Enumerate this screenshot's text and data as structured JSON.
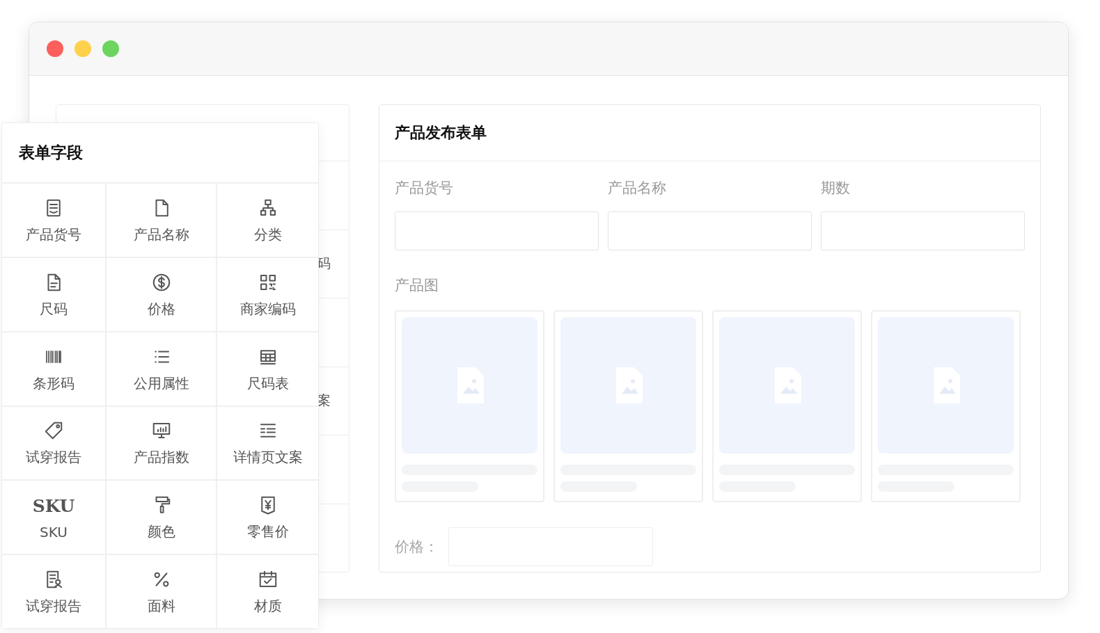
{
  "window": {
    "controls": [
      {
        "color": "#fc605c"
      },
      {
        "color": "#fdd14b"
      },
      {
        "color": "#6cd45f"
      }
    ]
  },
  "back_panel": {
    "rows": [
      {
        "text": ""
      },
      {
        "text": "码"
      },
      {
        "text": ""
      },
      {
        "text": "案"
      },
      {
        "text": ""
      },
      {
        "text": ""
      }
    ]
  },
  "field_palette": {
    "title": "表单字段",
    "items": [
      {
        "label": "产品货号",
        "kind": "icon"
      },
      {
        "label": "产品名称",
        "kind": "icon"
      },
      {
        "label": "分类",
        "kind": "icon"
      },
      {
        "label": "尺码",
        "kind": "icon"
      },
      {
        "label": "价格",
        "kind": "icon"
      },
      {
        "label": "商家编码",
        "kind": "icon"
      },
      {
        "label": "条形码",
        "kind": "icon"
      },
      {
        "label": "公用属性",
        "kind": "icon"
      },
      {
        "label": "尺码表",
        "kind": "icon"
      },
      {
        "label": "试穿报告",
        "kind": "icon"
      },
      {
        "label": "产品指数",
        "kind": "icon"
      },
      {
        "label": "详情页文案",
        "kind": "icon"
      },
      {
        "label": "SKU",
        "kind": "mark",
        "mark": "SKU"
      },
      {
        "label": "颜色",
        "kind": "icon"
      },
      {
        "label": "零售价",
        "kind": "icon"
      },
      {
        "label": "试穿报告",
        "kind": "icon"
      },
      {
        "label": "面料",
        "kind": "icon"
      },
      {
        "label": "材质",
        "kind": "icon"
      }
    ]
  },
  "form": {
    "title": "产品发布表单",
    "fields": [
      {
        "label": "产品货号"
      },
      {
        "label": "产品名称"
      },
      {
        "label": "期数"
      }
    ],
    "image_section": {
      "label": "产品图",
      "images": [
        {
          "kind": "placeholder"
        },
        {
          "kind": "placeholder"
        },
        {
          "kind": "placeholder"
        },
        {
          "kind": "placeholder"
        }
      ]
    },
    "price_row": {
      "label": "价格："
    }
  }
}
